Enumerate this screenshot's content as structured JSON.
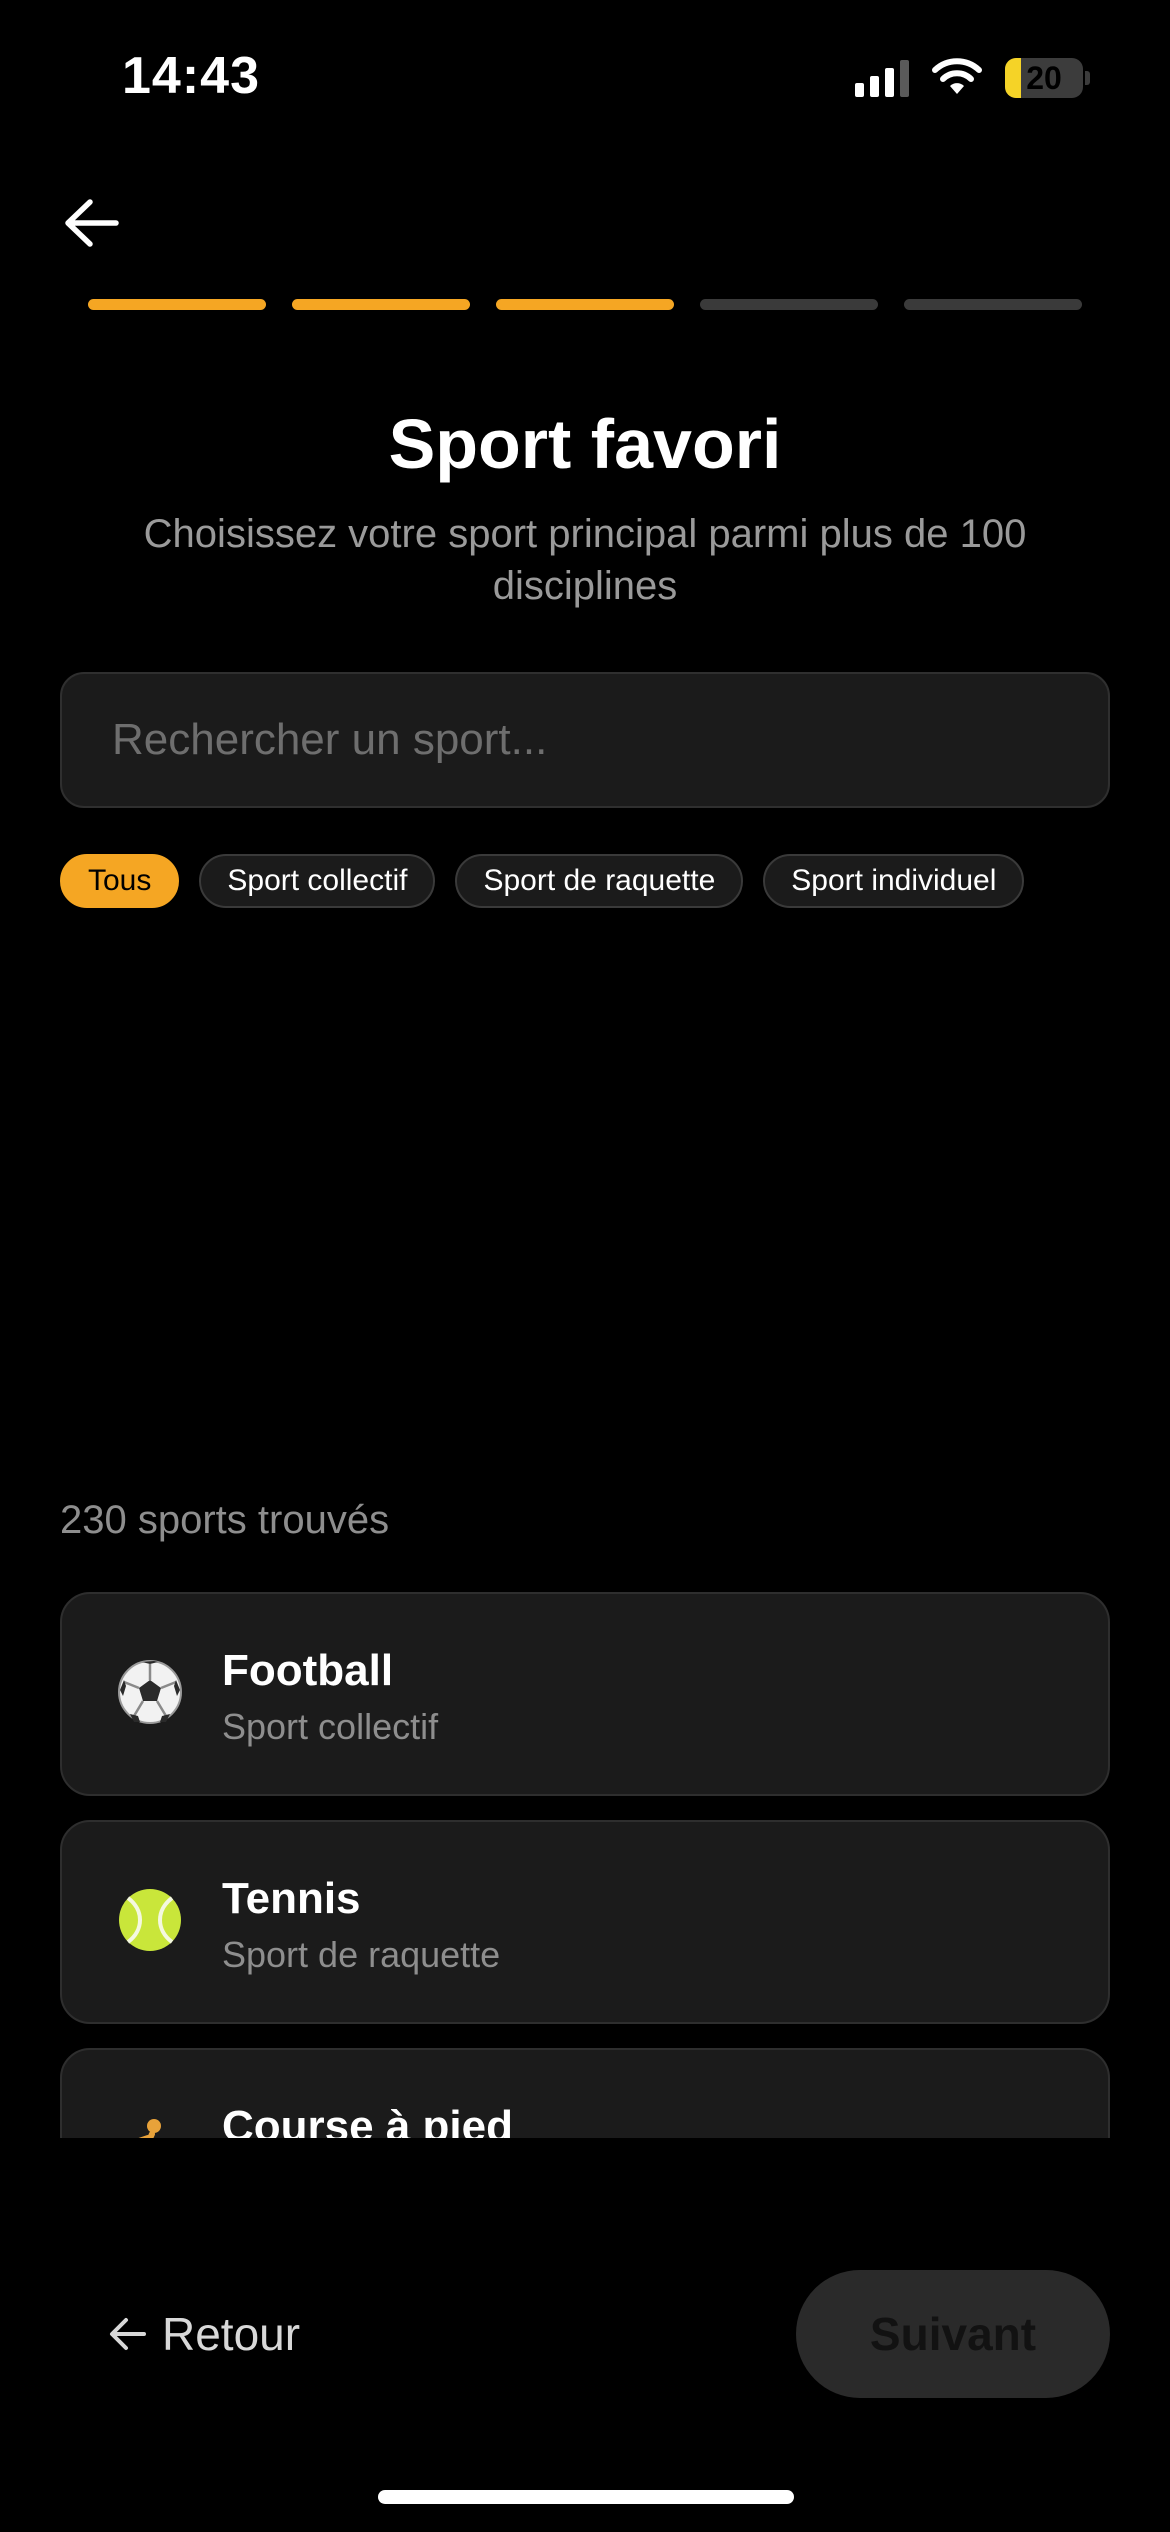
{
  "status_bar": {
    "time": "14:43",
    "battery_level": "20",
    "icons": [
      "signal-icon",
      "wifi-icon",
      "battery-icon"
    ]
  },
  "header": {
    "back_icon": "arrow-left-icon",
    "progress": {
      "total_steps": 5,
      "completed_steps": 3,
      "active_color": "#f5a623"
    }
  },
  "title": "Sport favori",
  "subtitle": "Choisissez votre sport principal parmi plus de 100 disciplines",
  "search": {
    "placeholder": "Rechercher un sport...",
    "value": ""
  },
  "filters": [
    {
      "label": "Tous",
      "active": true
    },
    {
      "label": "Sport collectif",
      "active": false
    },
    {
      "label": "Sport de raquette",
      "active": false
    },
    {
      "label": "Sport individuel",
      "active": false
    }
  ],
  "results_count": "230 sports trouvés",
  "sports": [
    {
      "name": "Football",
      "category": "Sport collectif",
      "icon": "soccer-ball-icon"
    },
    {
      "name": "Tennis",
      "category": "Sport de raquette",
      "icon": "tennis-ball-icon"
    },
    {
      "name": "Course à pied",
      "category": "",
      "icon": "runner-icon"
    }
  ],
  "footer": {
    "back_label": "Retour",
    "next_label": "Suivant"
  },
  "colors": {
    "accent": "#f5a623",
    "background": "#000000",
    "card": "#1b1b1b",
    "muted_text": "#8e8e8e"
  }
}
